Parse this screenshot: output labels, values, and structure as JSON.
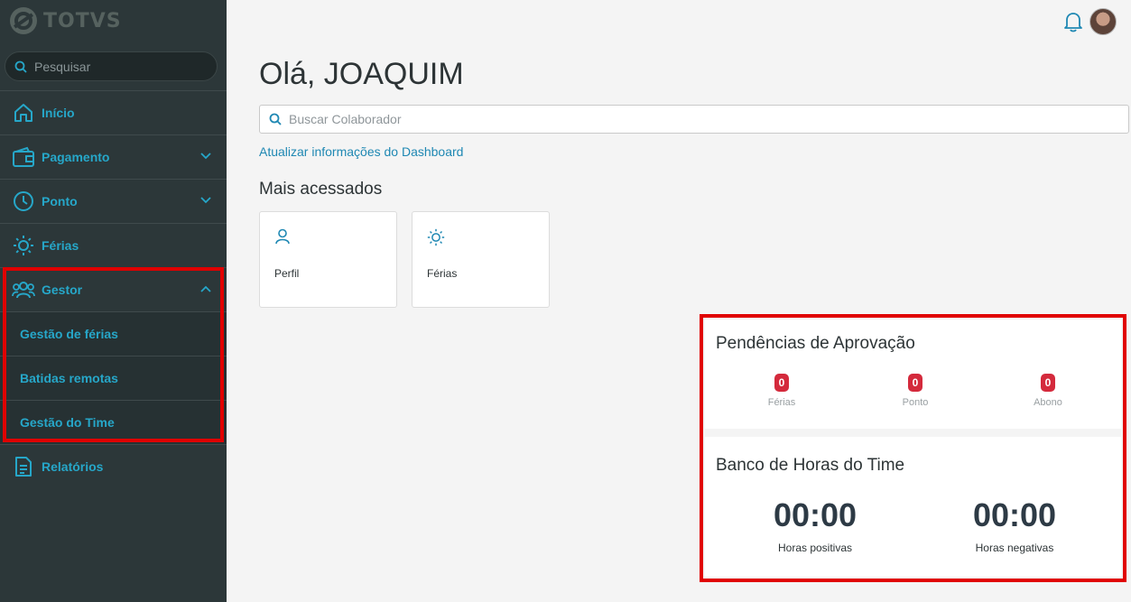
{
  "sidebar": {
    "logo_text": "TOTVS",
    "search_placeholder": "Pesquisar",
    "items": [
      {
        "label": "Início",
        "icon": "home-icon"
      },
      {
        "label": "Pagamento",
        "icon": "wallet-icon"
      },
      {
        "label": "Ponto",
        "icon": "clock-icon"
      },
      {
        "label": "Férias",
        "icon": "sun-icon"
      },
      {
        "label": "Gestor",
        "icon": "team-icon"
      },
      {
        "label": "Relatórios",
        "icon": "document-icon"
      }
    ],
    "gestor_subitems": [
      "Gestão de férias",
      "Batidas remotas",
      "Gestão do Time"
    ]
  },
  "header": {
    "greeting": "Olá, JOAQUIM",
    "collaborator_search_placeholder": "Buscar Colaborador",
    "update_link": "Atualizar informações do Dashboard"
  },
  "most_accessed": {
    "title": "Mais acessados",
    "cards": [
      {
        "label": "Perfil",
        "icon": "person-icon"
      },
      {
        "label": "Férias",
        "icon": "sun-icon"
      }
    ]
  },
  "pending_approvals": {
    "title": "Pendências de Aprovação",
    "items": [
      {
        "label": "Férias",
        "count": "0"
      },
      {
        "label": "Ponto",
        "count": "0"
      },
      {
        "label": "Abono",
        "count": "0"
      }
    ]
  },
  "team_hours": {
    "title": "Banco de Horas do Time",
    "positive": {
      "value": "00:00",
      "label": "Horas positivas"
    },
    "negative": {
      "value": "00:00",
      "label": "Horas negativas"
    }
  },
  "colors": {
    "sidebar_bg": "#2c3739",
    "accent": "#26a7c9",
    "highlight": "#e00000",
    "badge": "#d42a3c"
  }
}
